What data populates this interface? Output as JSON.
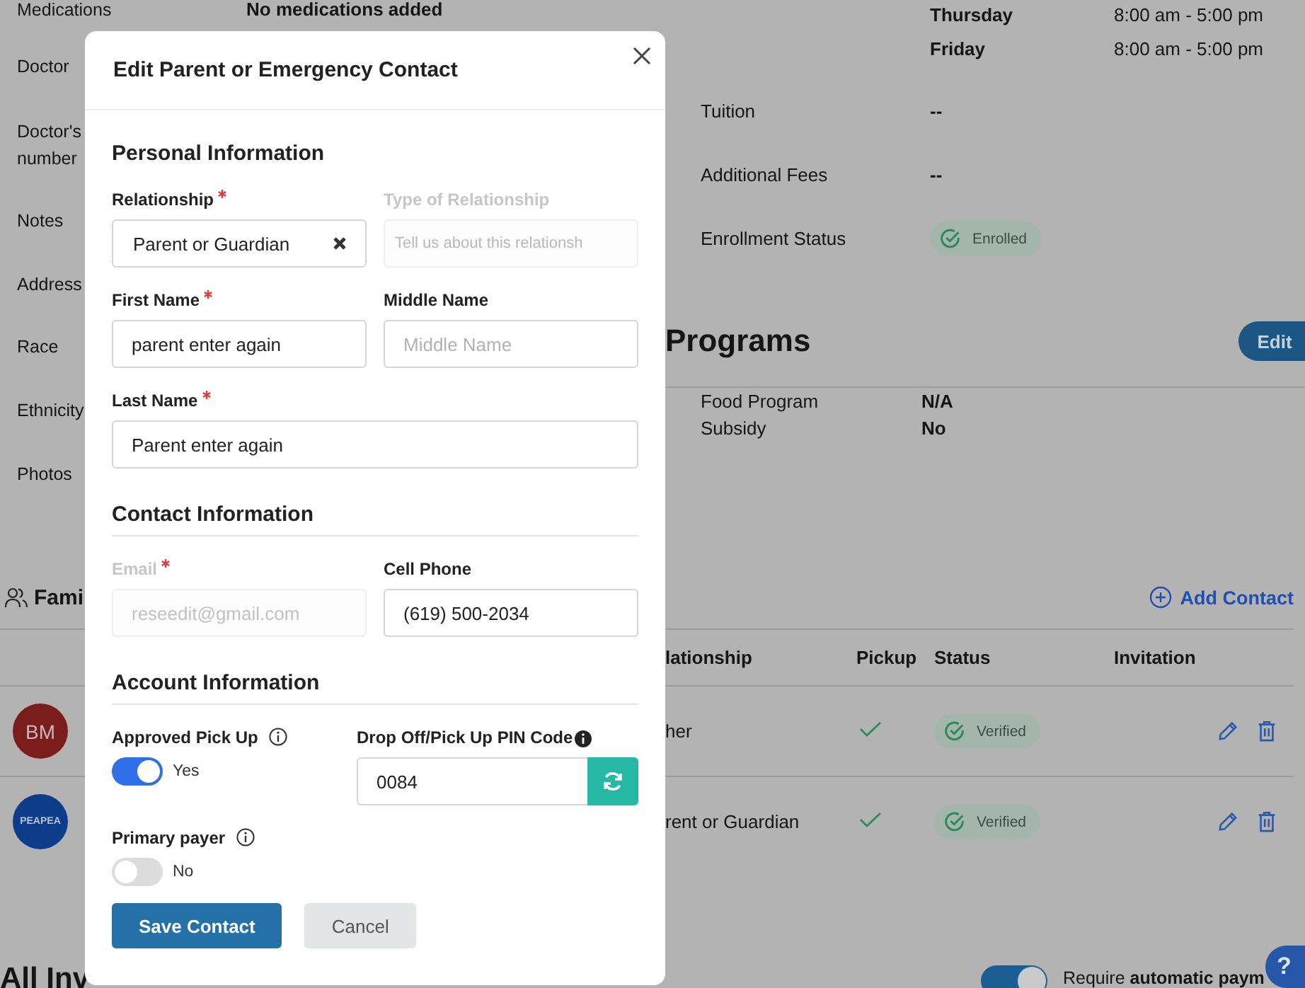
{
  "background": {
    "details": [
      {
        "label": "Medications",
        "value": "No medications added"
      },
      {
        "label": "Doctor"
      },
      {
        "label": "Doctor's number"
      },
      {
        "label": "Notes"
      },
      {
        "label": "Address"
      },
      {
        "label": "Race"
      },
      {
        "label": "Ethnicity"
      },
      {
        "label": "Photos"
      }
    ],
    "schedule": [
      {
        "day": "Thursday",
        "hours": "8:00 am - 5:00 pm"
      },
      {
        "day": "Friday",
        "hours": "8:00 am - 5:00 pm"
      }
    ],
    "enrollment": [
      {
        "label": "Tuition",
        "value": "--"
      },
      {
        "label": "Additional Fees",
        "value": "--"
      },
      {
        "label": "Enrollment Status",
        "badge": "Enrolled"
      }
    ],
    "programs": {
      "title": "Programs",
      "edit_button": "Edit",
      "rows": [
        {
          "label": "Food Program",
          "value": "N/A"
        },
        {
          "label": "Subsidy",
          "value": "No"
        }
      ]
    },
    "family": {
      "title": "Fami",
      "add_button": "Add Contact",
      "columns": [
        "lationship",
        "Pickup",
        "Status",
        "Invitation"
      ],
      "rows": [
        {
          "initials": "BM",
          "color": "#7c1d1d",
          "relationship": "her",
          "pickup": true,
          "status": "Verified"
        },
        {
          "initials": "PEAPEA",
          "color": "#0d3c8a",
          "relationship": "rent or Guardian",
          "pickup": true,
          "status": "Verified"
        }
      ]
    },
    "invoices": {
      "title": "All Inv",
      "autopay": {
        "on": true,
        "label": "Require **automatic paym**"
      },
      "help": "?"
    }
  },
  "modal": {
    "title": "Edit Parent or Emergency Contact",
    "sections": [
      {
        "title": "Personal Information",
        "rows": [
          [
            {
              "kind": "select",
              "label": "Relationship",
              "required": true,
              "disabled": false,
              "value": "Parent or Guardian"
            },
            {
              "kind": "text",
              "label": "Type of Relationship",
              "required": false,
              "disabled": true,
              "placeholder": "Tell us about this relationsh"
            }
          ],
          [
            {
              "kind": "text",
              "label": "First Name",
              "required": true,
              "disabled": false,
              "value": "parent enter again"
            },
            {
              "kind": "text",
              "label": "Middle Name",
              "required": false,
              "disabled": false,
              "placeholder": "Middle Name"
            }
          ],
          [
            {
              "kind": "text",
              "label": "Last Name",
              "required": true,
              "disabled": false,
              "value": "Parent enter again"
            }
          ]
        ]
      },
      {
        "title": "Contact Information",
        "rows": [
          [
            {
              "kind": "text",
              "label": "Email",
              "required": true,
              "disabled": true,
              "value": "reseedit@gmail.com"
            },
            {
              "kind": "text",
              "label": "Cell Phone",
              "required": false,
              "disabled": false,
              "value": "(619) 500-2034"
            }
          ]
        ]
      },
      {
        "title": "Account Information",
        "rows": [
          [
            {
              "kind": "toggle",
              "label": "Approved Pick Up",
              "on": true,
              "state_label": "Yes"
            },
            {
              "kind": "pin",
              "label": "Drop Off/Pick Up PIN Code",
              "value": "0084"
            }
          ],
          [
            {
              "kind": "toggle",
              "label": "Primary payer",
              "on": false,
              "state_label": "No"
            }
          ]
        ]
      }
    ],
    "buttons": [
      {
        "label": "Save Contact",
        "kind": "primary"
      },
      {
        "label": "Cancel",
        "kind": "secondary"
      }
    ]
  }
}
